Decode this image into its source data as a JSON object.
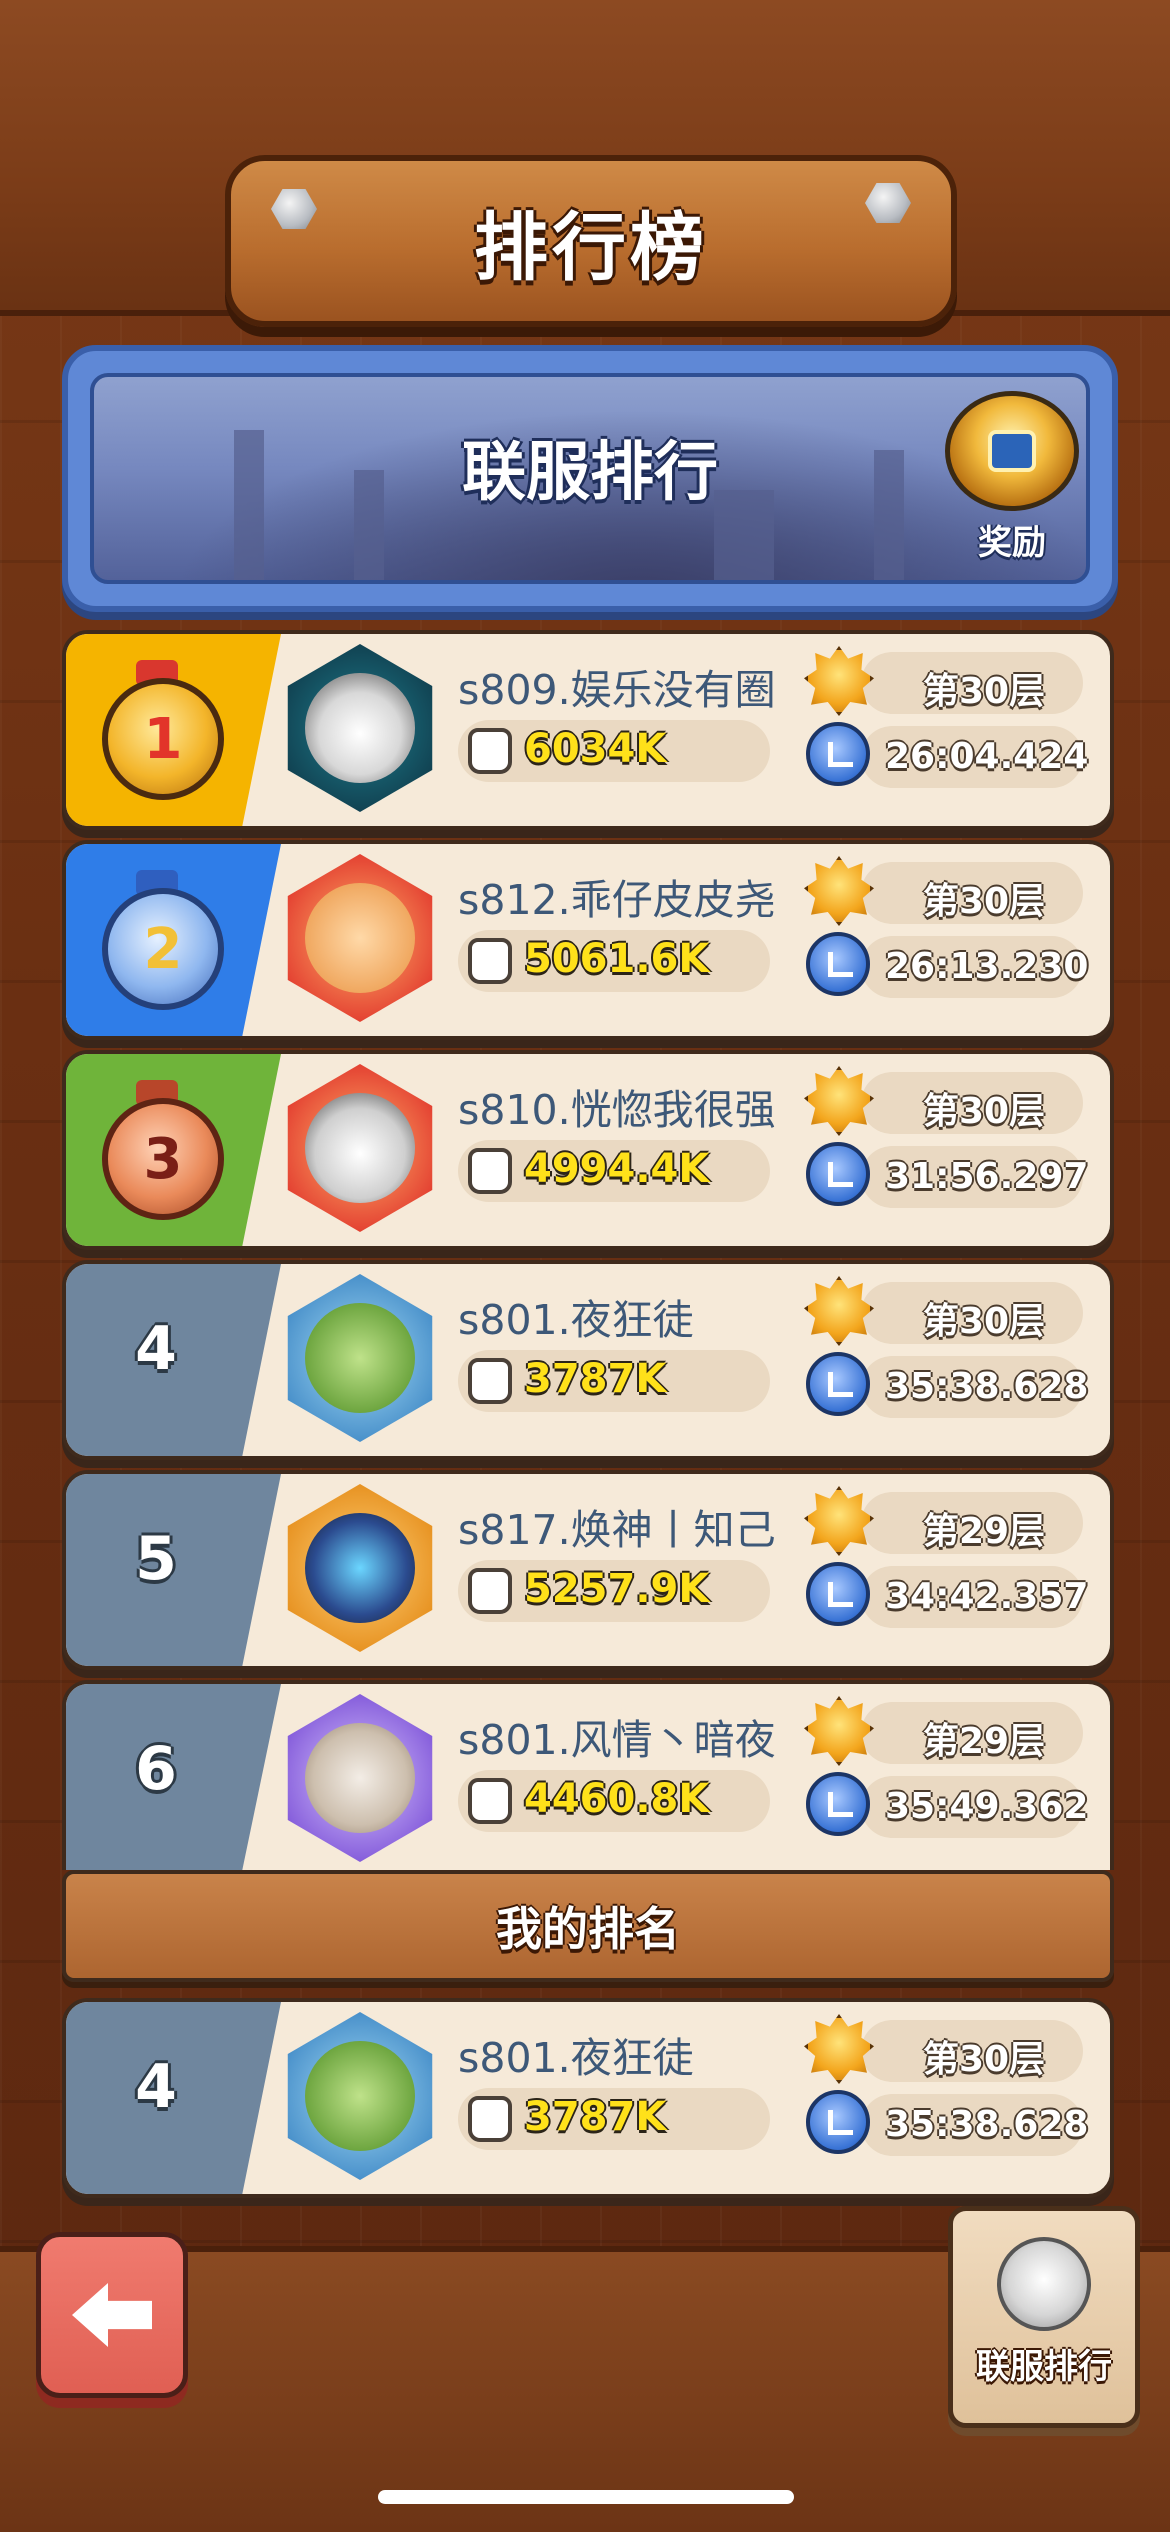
{
  "header": {
    "title": "排行榜"
  },
  "banner": {
    "title": "联服排行",
    "reward_label": "奖励"
  },
  "rankings": [
    {
      "rank": "1",
      "medal": "gold-medal-1",
      "name": "s809.娱乐没有圈",
      "power": "6034K",
      "floor": "第30层",
      "time": "26:04.424",
      "avatar": "panda-hero-avatar"
    },
    {
      "rank": "2",
      "medal": "silver-medal-2",
      "name": "s812.乖仔皮皮尧",
      "power": "5061.6K",
      "floor": "第30层",
      "time": "26:13.230",
      "avatar": "fire-girl-avatar"
    },
    {
      "rank": "3",
      "medal": "bronze-medal-3",
      "name": "s810.恍惚我很强",
      "power": "4994.4K",
      "floor": "第30层",
      "time": "31:56.297",
      "avatar": "fire-panda-avatar"
    },
    {
      "rank": "4",
      "name": "s801.夜狂徒",
      "power": "3787K",
      "floor": "第30层",
      "time": "35:38.628",
      "avatar": "croc-hero-avatar"
    },
    {
      "rank": "5",
      "name": "s817.焕神丨知己",
      "power": "5257.9K",
      "floor": "第29层",
      "time": "34:42.357",
      "avatar": "masked-hero-avatar"
    },
    {
      "rank": "6",
      "name": "s801.风情丶暗夜",
      "power": "4460.8K",
      "floor": "第29层",
      "time": "35:49.362",
      "avatar": "purple-mage-avatar"
    }
  ],
  "my_rank_header": "我的排名",
  "my_rank": {
    "rank": "4",
    "name": "s801.夜狂徒",
    "power": "3787K",
    "floor": "第30层",
    "time": "35:38.628",
    "avatar": "croc-hero-avatar"
  },
  "footer": {
    "server_ranking_label": "联服排行",
    "back_icon": "back-arrow-icon"
  },
  "colors": {
    "gold": "#f5b400",
    "blue": "#2f7de8",
    "green": "#6fb43a",
    "slate": "#6f869e",
    "power_text": "#ffe11a",
    "name_text": "#3d5878"
  }
}
